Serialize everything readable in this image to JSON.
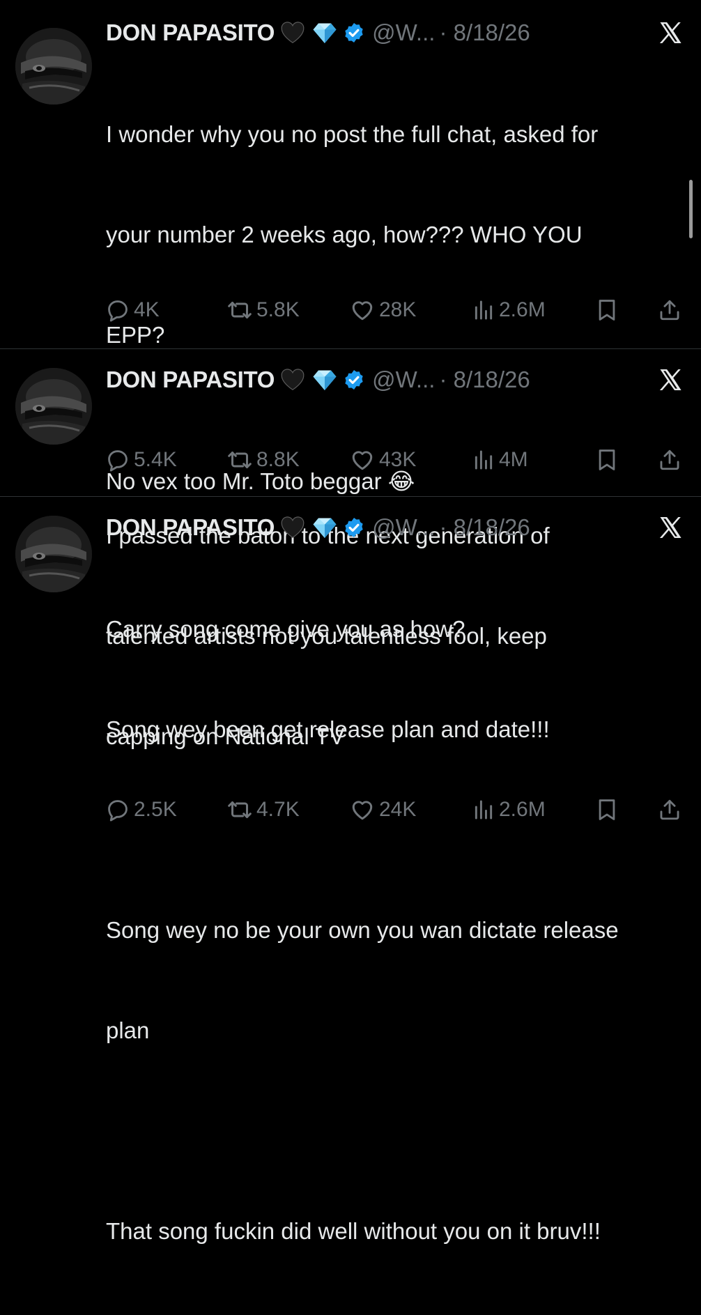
{
  "colors": {
    "background": "#000000",
    "text": "#e7e9ea",
    "muted": "#71767b",
    "verified": "#1d9bf0"
  },
  "tweets": [
    {
      "author": "DON PAPASITO",
      "badges": [
        "black-heart-icon",
        "gem-stone-icon",
        "verified-badge-icon"
      ],
      "handle": "@W...",
      "date": "· 8/18/26",
      "lines": [
        "I wonder why you no post the full chat, asked for",
        "your number 2 weeks ago, how??? WHO YOU",
        "EPP?",
        "",
        "I passed the baton to the next generation of",
        "talented artists not you talentless fool, keep",
        "capping on National TV"
      ],
      "replies": "4K",
      "reposts": "5.8K",
      "likes": "28K",
      "views": "2.6M"
    },
    {
      "author": "DON PAPASITO",
      "badges": [
        "black-heart-icon",
        "gem-stone-icon",
        "verified-badge-icon"
      ],
      "handle": "@W...",
      "date": "· 8/18/26",
      "lines": [
        "No vex too Mr. Toto beggar 😂"
      ],
      "replies": "5.4K",
      "reposts": "8.8K",
      "likes": "43K",
      "views": "4M"
    },
    {
      "author": "DON PAPASITO",
      "badges": [
        "black-heart-icon",
        "gem-stone-icon",
        "verified-badge-icon"
      ],
      "handle": "@W...",
      "date": "· 8/18/26",
      "lines": [
        "Carry song come give you as how?",
        "Song wey been get release plan and date!!!",
        "",
        "Song wey no be your own you wan dictate release",
        "plan",
        "",
        "That song fuckin did well without you on it bruv!!!"
      ],
      "replies": "2.5K",
      "reposts": "4.7K",
      "likes": "24K",
      "views": "2.6M"
    }
  ]
}
